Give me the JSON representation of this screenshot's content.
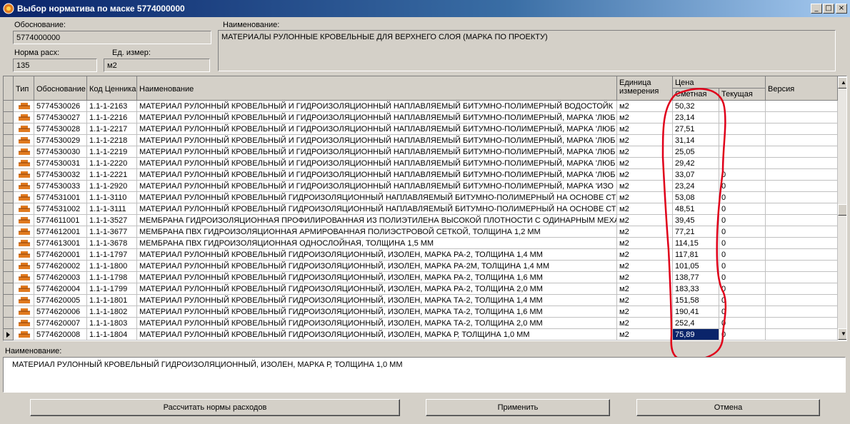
{
  "window": {
    "title": "Выбор норматива по маске 5774000000",
    "controls": [
      "_",
      "□",
      "×"
    ]
  },
  "form": {
    "basis_label": "Обоснование:",
    "basis_value": "5774000000",
    "name_label": "Наименование:",
    "name_value": "МАТЕРИАЛЫ РУЛОННЫЕ КРОВЕЛЬНЫЕ ДЛЯ ВЕРХНЕГО СЛОЯ (МАРКА ПО ПРОЕКТУ)",
    "norm_label": "Норма расх:",
    "norm_value": "135",
    "unit_label": "Ед. измер:",
    "unit_value": "м2"
  },
  "grid": {
    "headers": {
      "type": "Тип",
      "basis": "Обоснование",
      "code": "Код Ценника",
      "name": "Наименование",
      "unit_line1": "Единица",
      "unit_line2": "измерения",
      "price": "Цена",
      "estimate": "Сметная",
      "current": "Текущая",
      "version": "Версия"
    },
    "rows": [
      {
        "basis": "5774530026",
        "code": "1.1-1-2163",
        "name": "МАТЕРИАЛ РУЛОННЫЙ КРОВЕЛЬНЫЙ И ГИДРОИЗОЛЯЦИОННЫЙ НАПЛАВЛЯЕМЫЙ БИТУМНО-ПОЛИМЕРНЫЙ ВОДОСТОЙК",
        "unit": "м2",
        "estimate": "50,32",
        "current": "",
        "version": ""
      },
      {
        "basis": "5774530027",
        "code": "1.1-1-2216",
        "name": "МАТЕРИАЛ РУЛОННЫЙ КРОВЕЛЬНЫЙ И ГИДРОИЗОЛЯЦИОННЫЙ НАПЛАВЛЯЕМЫЙ БИТУМНО-ПОЛИМЕРНЫЙ, МАРКА 'ЛЮБ",
        "unit": "м2",
        "estimate": "23,14",
        "current": "",
        "version": ""
      },
      {
        "basis": "5774530028",
        "code": "1.1-1-2217",
        "name": "МАТЕРИАЛ РУЛОННЫЙ КРОВЕЛЬНЫЙ И ГИДРОИЗОЛЯЦИОННЫЙ НАПЛАВЛЯЕМЫЙ БИТУМНО-ПОЛИМЕРНЫЙ, МАРКА 'ЛЮБ",
        "unit": "м2",
        "estimate": "27,51",
        "current": "",
        "version": ""
      },
      {
        "basis": "5774530029",
        "code": "1.1-1-2218",
        "name": "МАТЕРИАЛ РУЛОННЫЙ КРОВЕЛЬНЫЙ И ГИДРОИЗОЛЯЦИОННЫЙ НАПЛАВЛЯЕМЫЙ БИТУМНО-ПОЛИМЕРНЫЙ, МАРКА 'ЛЮБ",
        "unit": "м2",
        "estimate": "31,14",
        "current": "",
        "version": ""
      },
      {
        "basis": "5774530030",
        "code": "1.1-1-2219",
        "name": "МАТЕРИАЛ РУЛОННЫЙ КРОВЕЛЬНЫЙ И ГИДРОИЗОЛЯЦИОННЫЙ НАПЛАВЛЯЕМЫЙ БИТУМНО-ПОЛИМЕРНЫЙ, МАРКА 'ЛЮБ",
        "unit": "м2",
        "estimate": "25,05",
        "current": "",
        "version": ""
      },
      {
        "basis": "5774530031",
        "code": "1.1-1-2220",
        "name": "МАТЕРИАЛ РУЛОННЫЙ КРОВЕЛЬНЫЙ И ГИДРОИЗОЛЯЦИОННЫЙ НАПЛАВЛЯЕМЫЙ БИТУМНО-ПОЛИМЕРНЫЙ, МАРКА 'ЛЮБ",
        "unit": "м2",
        "estimate": "29,42",
        "current": "",
        "version": ""
      },
      {
        "basis": "5774530032",
        "code": "1.1-1-2221",
        "name": "МАТЕРИАЛ РУЛОННЫЙ КРОВЕЛЬНЫЙ И ГИДРОИЗОЛЯЦИОННЫЙ НАПЛАВЛЯЕМЫЙ БИТУМНО-ПОЛИМЕРНЫЙ, МАРКА 'ЛЮБ",
        "unit": "м2",
        "estimate": "33,07",
        "current": "0",
        "version": ""
      },
      {
        "basis": "5774530033",
        "code": "1.1-1-2920",
        "name": "МАТЕРИАЛ РУЛОННЫЙ КРОВЕЛЬНЫЙ И ГИДРОИЗОЛЯЦИОННЫЙ НАПЛАВЛЯЕМЫЙ БИТУМНО-ПОЛИМЕРНЫЙ, МАРКА 'ИЗО",
        "unit": "м2",
        "estimate": "23,24",
        "current": "0",
        "version": ""
      },
      {
        "basis": "5774531001",
        "code": "1.1-1-3110",
        "name": "МАТЕРИАЛ РУЛОННЫЙ КРОВЕЛЬНЫЙ ГИДРОИЗОЛЯЦИОННЫЙ НАПЛАВЛЯЕМЫЙ БИТУМНО-ПОЛИМЕРНЫЙ НА ОСНОВЕ СТ",
        "unit": "м2",
        "estimate": "53,08",
        "current": "0",
        "version": ""
      },
      {
        "basis": "5774531002",
        "code": "1.1-1-3111",
        "name": "МАТЕРИАЛ РУЛОННЫЙ КРОВЕЛЬНЫЙ ГИДРОИЗОЛЯЦИОННЫЙ НАПЛАВЛЯЕМЫЙ БИТУМНО-ПОЛИМЕРНЫЙ НА ОСНОВЕ СТ",
        "unit": "м2",
        "estimate": "48,51",
        "current": "0",
        "version": ""
      },
      {
        "basis": "5774611001",
        "code": "1.1-1-3527",
        "name": "МЕМБРАНА ГИДРОИЗОЛЯЦИОННАЯ ПРОФИЛИРОВАННАЯ ИЗ ПОЛИЭТИЛЕНА ВЫСОКОЙ ПЛОТНОСТИ С ОДИНАРНЫМ МЕХА",
        "unit": "м2",
        "estimate": "39,45",
        "current": "0",
        "version": ""
      },
      {
        "basis": "5774612001",
        "code": "1.1-1-3677",
        "name": "МЕМБРАНА ПВХ ГИДРОИЗОЛЯЦИОННАЯ АРМИРОВАННАЯ ПОЛИЭСТРОВОЙ СЕТКОЙ, ТОЛЩИНА 1,2 ММ",
        "unit": "м2",
        "estimate": "77,21",
        "current": "0",
        "version": ""
      },
      {
        "basis": "5774613001",
        "code": "1.1-1-3678",
        "name": "МЕМБРАНА ПВХ ГИДРОИЗОЛЯЦИОННАЯ ОДНОСЛОЙНАЯ, ТОЛЩИНА 1,5 ММ",
        "unit": "м2",
        "estimate": "114,15",
        "current": "0",
        "version": ""
      },
      {
        "basis": "5774620001",
        "code": "1.1-1-1797",
        "name": "МАТЕРИАЛ РУЛОННЫЙ КРОВЕЛЬНЫЙ ГИДРОИЗОЛЯЦИОННЫЙ, ИЗОЛЕН, МАРКА РА-2, ТОЛЩИНА 1,4 ММ",
        "unit": "м2",
        "estimate": "117,81",
        "current": "0",
        "version": ""
      },
      {
        "basis": "5774620002",
        "code": "1.1-1-1800",
        "name": "МАТЕРИАЛ РУЛОННЫЙ КРОВЕЛЬНЫЙ ГИДРОИЗОЛЯЦИОННЫЙ, ИЗОЛЕН, МАРКА РА-2М, ТОЛЩИНА 1,4 ММ",
        "unit": "м2",
        "estimate": "101,05",
        "current": "0",
        "version": ""
      },
      {
        "basis": "5774620003",
        "code": "1.1-1-1798",
        "name": "МАТЕРИАЛ РУЛОННЫЙ КРОВЕЛЬНЫЙ ГИДРОИЗОЛЯЦИОННЫЙ, ИЗОЛЕН, МАРКА РА-2, ТОЛЩИНА 1,6 ММ",
        "unit": "м2",
        "estimate": "138,77",
        "current": "0",
        "version": ""
      },
      {
        "basis": "5774620004",
        "code": "1.1-1-1799",
        "name": "МАТЕРИАЛ РУЛОННЫЙ КРОВЕЛЬНЫЙ ГИДРОИЗОЛЯЦИОННЫЙ, ИЗОЛЕН, МАРКА РА-2, ТОЛЩИНА 2,0 ММ",
        "unit": "м2",
        "estimate": "183,33",
        "current": "0",
        "version": ""
      },
      {
        "basis": "5774620005",
        "code": "1.1-1-1801",
        "name": "МАТЕРИАЛ РУЛОННЫЙ КРОВЕЛЬНЫЙ ГИДРОИЗОЛЯЦИОННЫЙ, ИЗОЛЕН, МАРКА ТА-2, ТОЛЩИНА 1,4 ММ",
        "unit": "м2",
        "estimate": "151,58",
        "current": "0",
        "version": ""
      },
      {
        "basis": "5774620006",
        "code": "1.1-1-1802",
        "name": "МАТЕРИАЛ РУЛОННЫЙ КРОВЕЛЬНЫЙ ГИДРОИЗОЛЯЦИОННЫЙ, ИЗОЛЕН, МАРКА ТА-2, ТОЛЩИНА 1,6 ММ",
        "unit": "м2",
        "estimate": "190,41",
        "current": "0",
        "version": ""
      },
      {
        "basis": "5774620007",
        "code": "1.1-1-1803",
        "name": "МАТЕРИАЛ РУЛОННЫЙ КРОВЕЛЬНЫЙ ГИДРОИЗОЛЯЦИОННЫЙ, ИЗОЛЕН, МАРКА ТА-2, ТОЛЩИНА 2,0 ММ",
        "unit": "м2",
        "estimate": "252,4",
        "current": "0",
        "version": ""
      },
      {
        "basis": "5774620008",
        "code": "1.1-1-1804",
        "name": "МАТЕРИАЛ РУЛОННЫЙ КРОВЕЛЬНЫЙ ГИДРОИЗОЛЯЦИОННЫЙ, ИЗОЛЕН, МАРКА Р, ТОЛЩИНА 1,0 ММ",
        "unit": "м2",
        "estimate": "75,89",
        "current": "0",
        "version": "",
        "selected": true
      }
    ]
  },
  "details": {
    "label": "Наименование:",
    "value": "МАТЕРИАЛ РУЛОННЫЙ КРОВЕЛЬНЫЙ ГИДРОИЗОЛЯЦИОННЫЙ, ИЗОЛЕН, МАРКА Р, ТОЛЩИНА 1,0 ММ"
  },
  "buttons": {
    "calculate": "Рассчитать нормы расходов",
    "apply": "Применить",
    "cancel": "Отмена"
  },
  "colors": {
    "selection": "#0a246a",
    "annotation": "#e0001a",
    "row_icon": "#e07a1f"
  }
}
